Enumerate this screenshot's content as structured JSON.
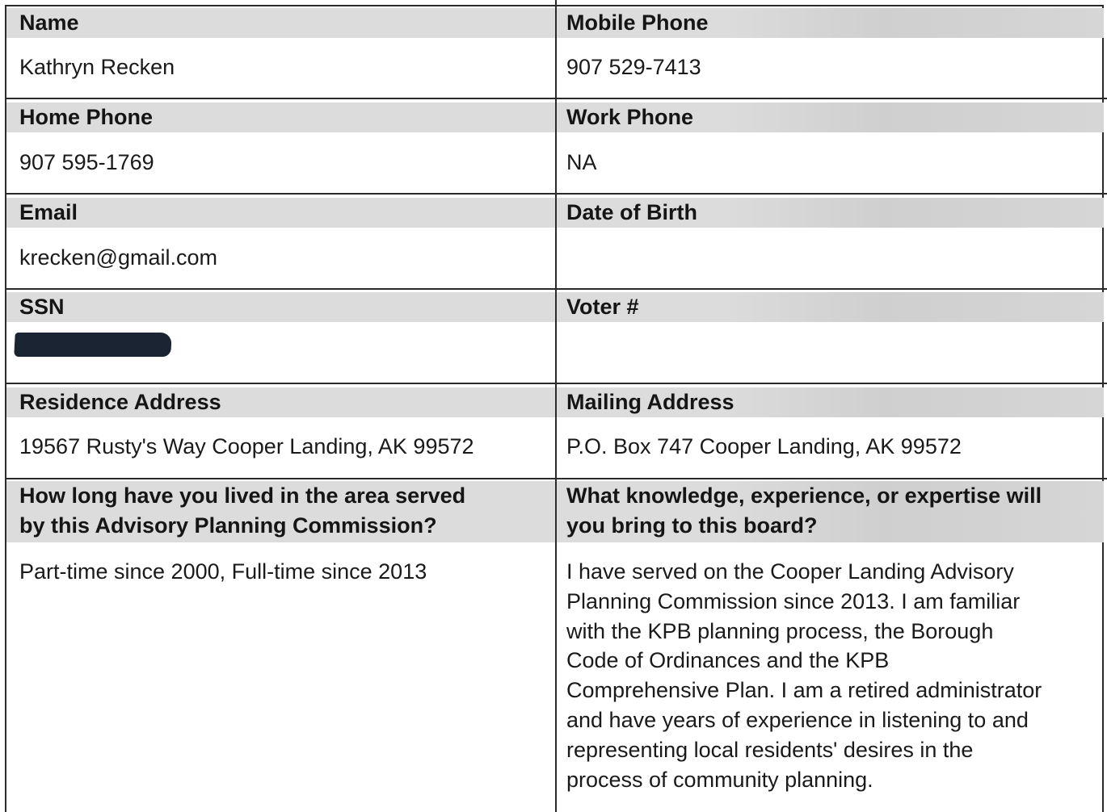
{
  "form": {
    "name": {
      "label": "Name",
      "value": "Kathryn Recken"
    },
    "mobile_phone": {
      "label": "Mobile Phone",
      "value": "907 529-7413"
    },
    "home_phone": {
      "label": "Home Phone",
      "value": "907 595-1769"
    },
    "work_phone": {
      "label": "Work Phone",
      "value": "NA"
    },
    "email": {
      "label": "Email",
      "value": "krecken@gmail.com"
    },
    "date_of_birth": {
      "label": "Date of Birth",
      "value": ""
    },
    "ssn": {
      "label": "SSN",
      "value": ""
    },
    "voter_number": {
      "label": "Voter #",
      "value": ""
    },
    "residence_address": {
      "label": "Residence Address",
      "value": "19567 Rusty's Way Cooper Landing, AK 99572"
    },
    "mailing_address": {
      "label": "Mailing Address",
      "value": "P.O. Box 747 Cooper Landing, AK 99572"
    },
    "residency_question": {
      "label_line1": "How long have you lived in the area served",
      "label_line2": "by this Advisory Planning Commission?",
      "value": "Part-time since 2000, Full-time since 2013"
    },
    "expertise_question": {
      "label_line1": "What knowledge, experience, or expertise will",
      "label_line2": "you bring to this board?",
      "value_lines": [
        "I have served on the Cooper Landing Advisory",
        "Planning Commission since 2013. I am familiar",
        "with the KPB planning process, the Borough",
        "Code of Ordinances and the KPB",
        "Comprehensive Plan. I am a retired administrator",
        "and have years of experience in listening to and",
        "representing local residents' desires in the",
        "process of community planning."
      ]
    }
  }
}
